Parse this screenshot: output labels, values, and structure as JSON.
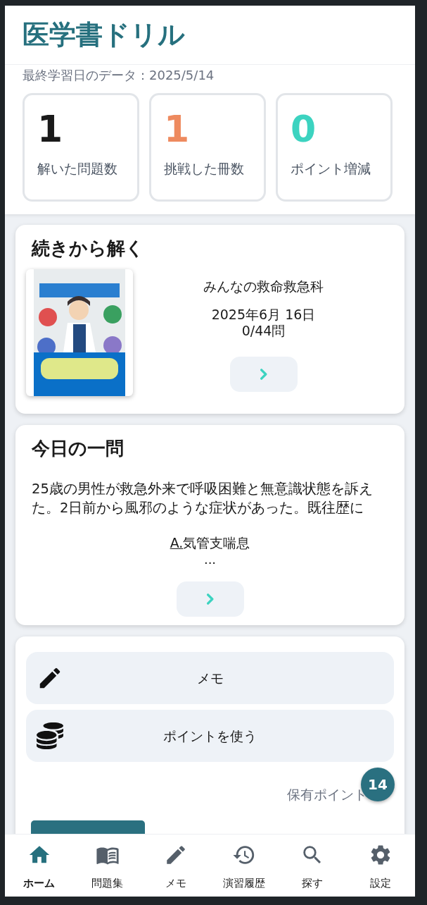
{
  "app_title": "医学書ドリル",
  "last_study": "最終学習日のデータ：2025/5/14",
  "stats": [
    {
      "value": "1",
      "label": "解いた問題数",
      "color": "#1a1a1a"
    },
    {
      "value": "1",
      "label": "挑戦した冊数",
      "color": "#ee8a5f"
    },
    {
      "value": "0",
      "label": "ポイント増減",
      "color": "#3cd3c0"
    }
  ],
  "continue": {
    "heading": "続きから解く",
    "book_title": "みんなの救命救急科",
    "date": "2025年6月 16日",
    "progress": "0/44問"
  },
  "daily": {
    "heading": "今日の一問",
    "question": "25歳の男性が救急外来で呼吸困難と無意識状態を訴えた。2日前から風邪のような症状があった。既往歴に",
    "answer_label": "A.",
    "answer_text": "気管支喘息",
    "ellipsis": "..."
  },
  "actions": [
    {
      "kind": "memo",
      "label": "メモ"
    },
    {
      "kind": "points",
      "label": "ポイントを使う"
    }
  ],
  "points_label": "保有ポイント",
  "points_badge": "14",
  "nav": [
    {
      "kind": "home",
      "label": "ホーム",
      "selected": true
    },
    {
      "kind": "book",
      "label": "問題集",
      "selected": false
    },
    {
      "kind": "memo",
      "label": "メモ",
      "selected": false
    },
    {
      "kind": "history",
      "label": "演習履歴",
      "selected": false
    },
    {
      "kind": "search",
      "label": "探す",
      "selected": false
    },
    {
      "kind": "settings",
      "label": "設定",
      "selected": false
    }
  ]
}
